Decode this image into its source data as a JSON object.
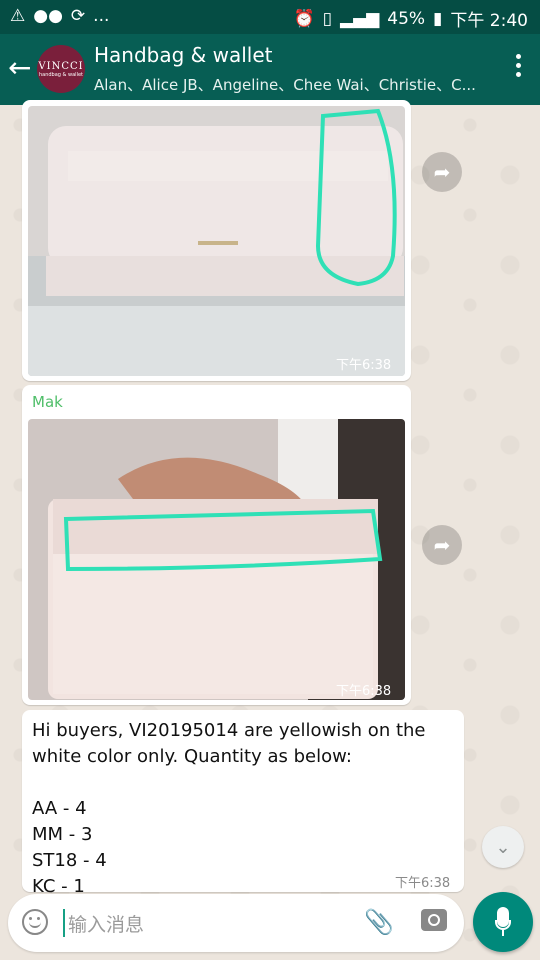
{
  "status_bar": {
    "left_icons": [
      "warning-icon",
      "wechat-icon",
      "sync-icon",
      "more-dots"
    ],
    "more_text": "...",
    "battery": "45%",
    "time": "下午 2:40"
  },
  "app_bar": {
    "avatar_logo": "VINCCI",
    "avatar_sub": "handbag & wallet",
    "title": "Handbag & wallet",
    "participants": "Alan、Alice JB、Angeline、Chee Wai、Christie、C..."
  },
  "messages": [
    {
      "type": "image",
      "time": "下午6:38",
      "caption": ""
    },
    {
      "type": "image",
      "sender": "Mak",
      "time": "下午6:38"
    },
    {
      "type": "text",
      "text": "Hi buyers, VI20195014 are yellowish on the\nwhite color only. Quantity as below:\n\nAA - 4\nMM - 3\nST18 - 4\nKC - 1",
      "time": "下午6:38"
    }
  ],
  "input": {
    "placeholder": "输入消息"
  },
  "colors": {
    "header": "#075e54",
    "accent": "#00897b",
    "sender_name": "#4fbe69"
  }
}
